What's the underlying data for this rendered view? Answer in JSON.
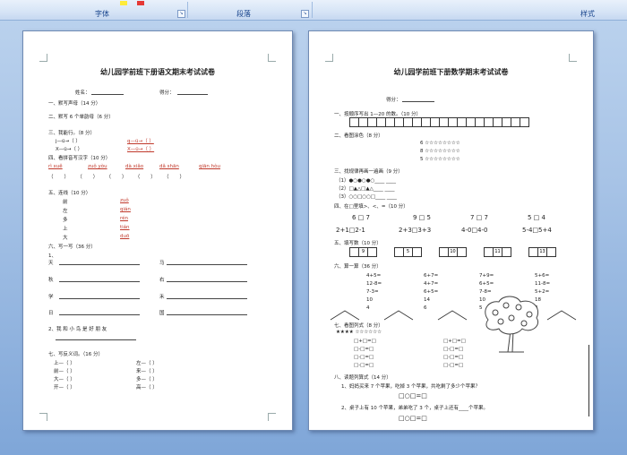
{
  "ribbon": {
    "font_group": "字体",
    "paragraph_group": "段落",
    "style_group": "样式",
    "launcher_icon": "dialog-launcher-icon"
  },
  "left_page": {
    "title": "幼儿园学前班下册语文期末考试试卷",
    "name_label": "姓名：",
    "score_label": "得分：",
    "q1": "一、默写声母（14 分）",
    "q2": "二、默写 6 个单韵母（6 分）",
    "q3": "三、我能行。（8 分）",
    "q3_items": [
      "j—ü→（    ）",
      "q—ü→（    ）",
      "X—ü→（    ）",
      "X—ü→（    ）"
    ],
    "q4": "四、看拼音写汉字（10 分）",
    "q4_pinyin": [
      "rì xuě",
      "zuǒ yòu",
      "dà xiǎo",
      "dǎ shān",
      "qiān hòu"
    ],
    "q5": "五、连线（10 分）",
    "q5_left": [
      "前",
      "左",
      "多",
      "上",
      "大"
    ],
    "q5_right": [
      "zuǒ",
      "qián",
      "rén",
      "tián",
      "duō"
    ],
    "q6": "六、写一写（36 分）",
    "q6_1": "1、",
    "q6_chars_left": [
      "天",
      "秋",
      "学",
      "日"
    ],
    "q6_chars_right": [
      "马",
      "右",
      "禾",
      "国"
    ],
    "q6_2": "2、我 和 小 鸟 是 好 朋 友",
    "q7": "七、写反义词。（16 分）",
    "q7_left": [
      "上—（    ）",
      "前—（    ）",
      "大—（    ）",
      "开—（    ）"
    ],
    "q7_right": [
      "左—（    ）",
      "来—（    ）",
      "多—（    ）",
      "高—（    ）"
    ]
  },
  "right_page": {
    "title": "幼儿园学前班下册数学期末考试试卷",
    "score_label": "得分：",
    "q1": "一、按顺序写出 1—20 的数。（10 分）",
    "q1_cells": 20,
    "q2": "二、看图涂色（8 分）",
    "q2_rows": [
      "6  ☆☆☆☆☆☆☆☆",
      "8  ☆☆☆☆☆☆☆☆",
      "5  ☆☆☆☆☆☆☆☆"
    ],
    "q3": "三、找规律再画一遍画（9 分）",
    "q3_rows": [
      "（1）●○●○●○____  ____",
      "（2）□▲△□▲△____  ____",
      "（3）○○□○○□____  ____"
    ],
    "q4": "四、在□里填>、<、=（10 分）",
    "q4_row1": [
      "6 □ 7",
      "9 □ 5",
      "7 □ 7",
      "5 □ 4"
    ],
    "q4_row2": [
      "2+1□2-1",
      "2+3□3+3",
      "4-0□4-0",
      "5-4□5+4"
    ],
    "q5": "五、填写数（10 分）",
    "q5_values": [
      "9",
      "5",
      "10",
      "11",
      "13"
    ],
    "q6": "六、算一算（36 分）",
    "q6_row1": [
      "4+5=",
      "6+7=",
      "7+9=",
      "5+6="
    ],
    "q6_row2": [
      "12-8=",
      "4+7=",
      "6+5=",
      "11-8="
    ],
    "q6_row3": [
      "7-3=",
      "6+5=",
      "7-8=",
      "5+2="
    ],
    "q6_row4": [
      "10",
      "14",
      "10",
      "18"
    ],
    "q6_row5": [
      "4",
      "6",
      "5",
      "3"
    ],
    "q7": "七、看图列式（8 分）",
    "q7_stars": "★★★★ ☆☆☆☆☆☆",
    "q7_eq": [
      "□+□=□",
      "□+□=□",
      "□-□=□",
      "□-□=□"
    ],
    "q8": "八、读题列算式（14 分）",
    "q8_1": "1、妈妈买来 7 个苹果，吃掉 3 个苹果，共吃剩了多少个苹果？",
    "q8_2": "2、桌子上有 10 个苹果，弟弟吃了 3 个，桌子上还有____个苹果。",
    "q8_answer": "□○□=□"
  }
}
